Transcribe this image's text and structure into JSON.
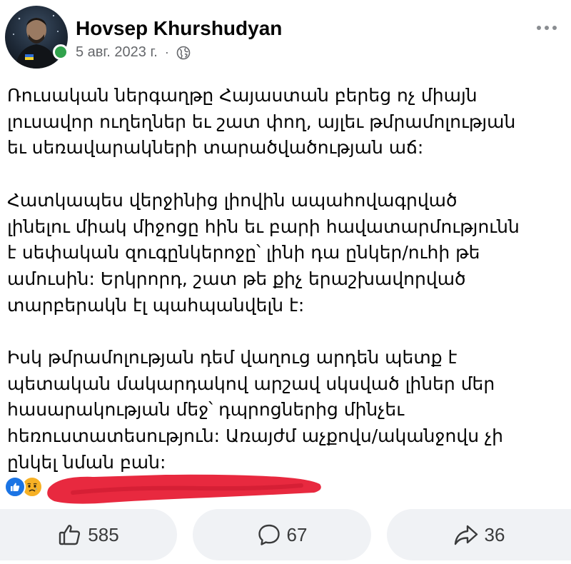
{
  "post": {
    "author": "Hovsep Khurshudyan",
    "date": "5 авг. 2023 г.",
    "separator": "·",
    "privacy_icon": "globe-icon",
    "more_icon": "more-horizontal-icon",
    "paragraphs": [
      "Ռուսական ներգաղթը Հայաստան բերեց ոչ միայն\nլուսավոր ուղեղներ եւ շատ փող, այլեւ թմրամոլության\nեւ սեռավարակների տարածվածության աճ:",
      "Հատկապես վերջինից լիովին ապահովագրված\nլինելու միակ միջոցը հին եւ բարի հավատարմությունն\nէ սեփական զուգընկերոջը՝ լինի դա ընկեր/ուհի թե\nամուսին: Երկրորդ, շատ թե քիչ երաշխավորված\nտարբերակն էլ պահպանվելն է:",
      "Իսկ թմրամոլության դեմ վաղուց արդեն պետք է\nպետական մակարդակով արշավ սկսված լիներ մեր\nհասարակության մեջ՝ դպրոցներից մինչեւ\nհեռուստատեսություն: Առայժմ աչքովս/ականջովս չի\nընկել նման բան:"
    ],
    "reactions": {
      "icons": [
        "like-reaction-icon",
        "sad-reaction-icon"
      ]
    }
  },
  "actions": {
    "like": {
      "icon": "thumbs-up-icon",
      "count": "585"
    },
    "comment": {
      "icon": "comment-icon",
      "count": "67"
    },
    "share": {
      "icon": "share-icon",
      "count": "36"
    }
  },
  "colors": {
    "online": "#31a24c",
    "like_blue": "#1b74e4",
    "sad_yellow": "#f7b125",
    "redaction_red": "#e8293f",
    "button_bg": "#f0f2f5",
    "meta_gray": "#65676b"
  }
}
